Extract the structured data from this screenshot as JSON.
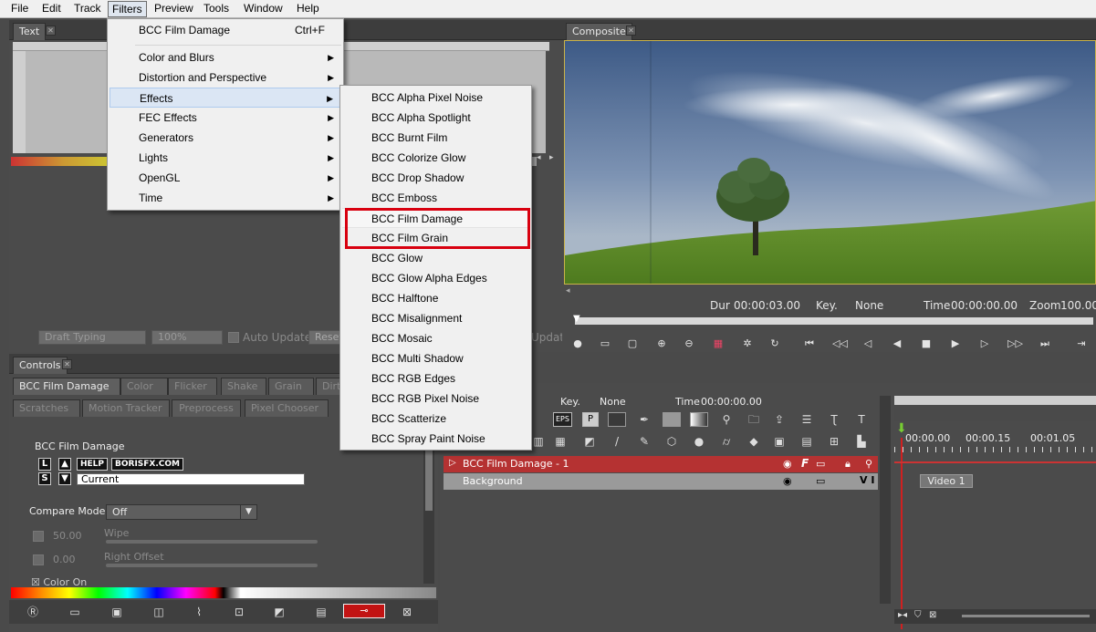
{
  "menubar": [
    "File",
    "Edit",
    "Track",
    "Filters",
    "Preview",
    "Tools",
    "Window",
    "Help"
  ],
  "filters_menu": {
    "top_item": "BCC Film Damage",
    "top_shortcut": "Ctrl+F",
    "items": [
      "Color and Blurs",
      "Distortion and Perspective",
      "Effects",
      "FEC Effects",
      "Generators",
      "Lights",
      "OpenGL",
      "Time"
    ]
  },
  "effects_menu": {
    "items": [
      "BCC Alpha Pixel Noise",
      "BCC Alpha Spotlight",
      "BCC Burnt Film",
      "BCC Colorize Glow",
      "BCC Drop Shadow",
      "BCC Emboss",
      "BCC Film Damage",
      "BCC Film Grain",
      "BCC Glow",
      "BCC Glow Alpha Edges",
      "BCC Halftone",
      "BCC Misalignment",
      "BCC Mosaic",
      "BCC Multi Shadow",
      "BCC RGB Edges",
      "BCC RGB Pixel Noise",
      "BCC Scatterize",
      "BCC Spray Paint Noise"
    ],
    "highlight_color": "#d8000f"
  },
  "text_panel": {
    "tab": "Text",
    "draft_typing": "Draft Typing",
    "zoom": "100%",
    "auto_update": "Auto Update",
    "reset": "Reset",
    "update": "Update"
  },
  "composite": {
    "tab": "Composite",
    "dur_label": "Dur",
    "dur_value": "00:00:03.00",
    "key_label": "Key.",
    "key_value": "None",
    "time_label": "Time",
    "time_value": "00:00:00.00",
    "zoom_label": "Zoom",
    "zoom_value": "100.00"
  },
  "controls": {
    "tab": "Controls",
    "tabs_row1": [
      "BCC Film Damage",
      "Color",
      "Flicker",
      "Shake",
      "Grain",
      "Dirt"
    ],
    "tabs_row2": [
      "Scratches",
      "Motion Tracker",
      "Preprocess",
      "Pixel Chooser"
    ],
    "filter_name": "BCC Film Damage",
    "btn_l": "L",
    "btn_s": "S",
    "help": "HELP",
    "borisfx": "BORISFX.COM",
    "preset": "Current",
    "compare_mode_label": "Compare Mode",
    "compare_mode_value": "Off",
    "wipe_value": "50.00",
    "wipe_label": "Wipe",
    "right_offset_value": "0.00",
    "right_offset_label": "Right Offset",
    "color_on": "Color On"
  },
  "timeline": {
    "key_label": "Key.",
    "key_value": "None",
    "time_label": "Time",
    "time_value": "00:00:00.00",
    "eps_label": "EPS",
    "p_label": "P",
    "ruler": [
      "00:00.00",
      "00:00.15",
      "00:01.05"
    ],
    "tracks": [
      {
        "name": "BCC Film Damage - 1",
        "badge": "F",
        "color": "#b53232"
      },
      {
        "name": "Background",
        "badge": "V I",
        "color": "#9a9a9a"
      }
    ],
    "clip_label": "Video 1"
  }
}
